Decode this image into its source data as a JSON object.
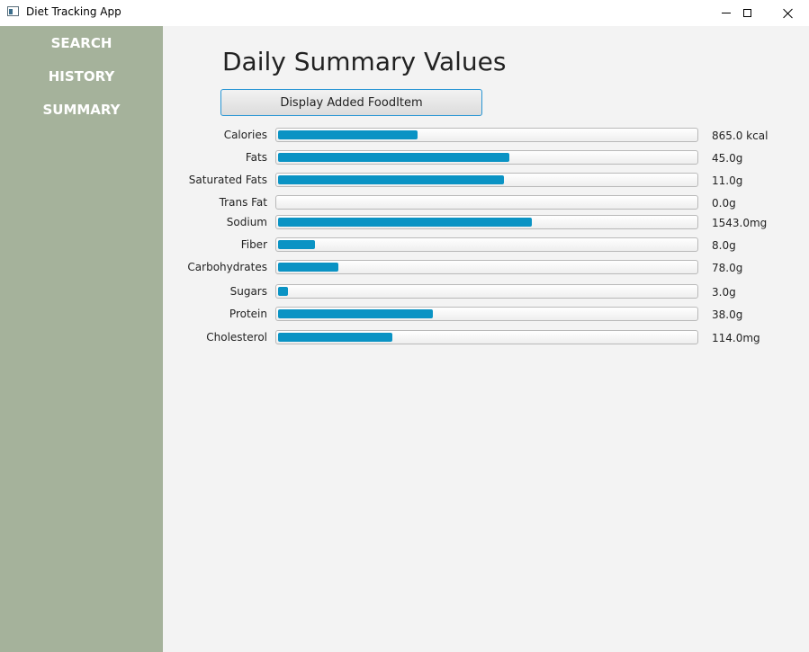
{
  "window": {
    "title": "Diet Tracking App"
  },
  "sidebar": {
    "items": [
      {
        "label": "SEARCH"
      },
      {
        "label": "HISTORY"
      },
      {
        "label": "SUMMARY"
      }
    ]
  },
  "main": {
    "title": "Daily Summary Values",
    "display_button": "Display Added FoodItem"
  },
  "colors": {
    "sidebar": "#a5b29b",
    "bar_fill": "#0a93c4",
    "button_border": "#2a96d4",
    "background": "#f3f3f3"
  },
  "nutrients": [
    {
      "label": "Calories",
      "value": "865.0 kcal",
      "fraction": 0.335
    },
    {
      "label": "Fats",
      "value": "45.0g",
      "fraction": 0.553
    },
    {
      "label": "Saturated Fats",
      "value": "11.0g",
      "fraction": 0.542
    },
    {
      "label": "Trans Fat",
      "value": "0.0g",
      "fraction": 0.0
    },
    {
      "label": "Sodium",
      "value": "1543.0mg",
      "fraction": 0.607
    },
    {
      "label": "Fiber",
      "value": "8.0g",
      "fraction": 0.089
    },
    {
      "label": "Carbohydrates",
      "value": "78.0g",
      "fraction": 0.145
    },
    {
      "label": "Sugars",
      "value": "3.0g",
      "fraction": 0.024
    },
    {
      "label": "Protein",
      "value": "38.0g",
      "fraction": 0.371
    },
    {
      "label": "Cholesterol",
      "value": "114.0mg",
      "fraction": 0.274
    }
  ]
}
